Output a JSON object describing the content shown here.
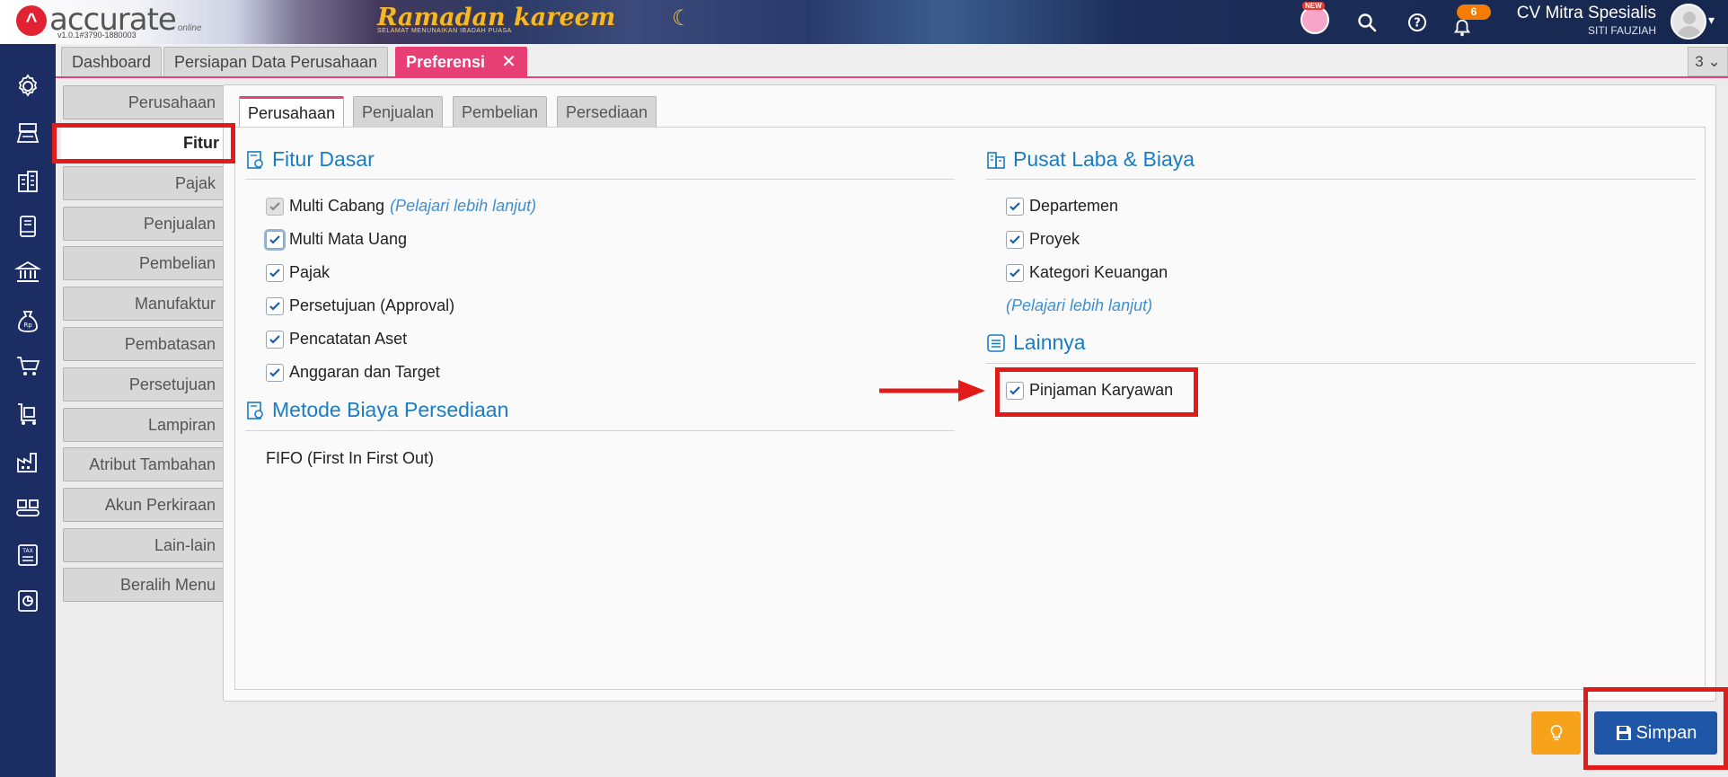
{
  "header": {
    "logo_text": "accurate",
    "logo_online": "online",
    "version": "v1.0.1#3790-1880003",
    "banner_title": "Ramadan kareem",
    "banner_sub": "SELAMAT MENUNAIKAN IBADAH PUASA",
    "new_badge": "NEW",
    "notification_count": "6",
    "company_name": "CV Mitra Spesialis",
    "user_name": "SITI FAUZIAH",
    "icons": [
      "mascot-icon",
      "search-icon",
      "help-icon",
      "bell-icon",
      "avatar",
      "chevron-down-icon"
    ]
  },
  "page_tabs": [
    {
      "label": "Dashboard"
    },
    {
      "label": "Persiapan Data Perusahaan"
    },
    {
      "label": "Preferensi",
      "active": true
    }
  ],
  "tab_count": "3",
  "left_nav_icons": [
    "settings-icon",
    "cash-register-icon",
    "building-icon",
    "book-icon",
    "bank-icon",
    "money-bag-icon",
    "shopping-cart-icon",
    "delivery-cart-icon",
    "factory-icon",
    "conveyor-icon",
    "tax-icon",
    "report-chart-icon"
  ],
  "pref_menu": [
    "Perusahaan",
    "Fitur",
    "Pajak",
    "Penjualan",
    "Pembelian",
    "Manufaktur",
    "Pembatasan",
    "Persetujuan",
    "Lampiran",
    "Atribut Tambahan",
    "Akun Perkiraan",
    "Lain-lain",
    "Beralih Menu"
  ],
  "pref_menu_active": "Fitur",
  "sub_tabs": [
    "Perusahaan",
    "Penjualan",
    "Pembelian",
    "Persediaan"
  ],
  "fitur_dasar": {
    "title": "Fitur Dasar",
    "items": [
      {
        "label": "Multi Cabang",
        "note": "(Pelajari lebih lanjut)",
        "checked": true,
        "disabled": true
      },
      {
        "label": "Multi Mata Uang",
        "checked": true
      },
      {
        "label": "Pajak",
        "checked": true
      },
      {
        "label": "Persetujuan (Approval)",
        "checked": true
      },
      {
        "label": "Pencatatan Aset",
        "checked": true
      },
      {
        "label": "Anggaran dan Target",
        "checked": true
      }
    ]
  },
  "metode_biaya": {
    "title": "Metode Biaya Persediaan",
    "value": "FIFO (First In First Out)"
  },
  "pusat_laba": {
    "title": "Pusat Laba & Biaya",
    "items": [
      {
        "label": "Departemen",
        "checked": true
      },
      {
        "label": "Proyek",
        "checked": true
      },
      {
        "label": "Kategori Keuangan",
        "checked": true
      }
    ],
    "note": "(Pelajari lebih lanjut)"
  },
  "lainnya": {
    "title": "Lainnya",
    "items": [
      {
        "label": "Pinjaman Karyawan",
        "checked": true
      }
    ]
  },
  "buttons": {
    "idea_icon": "lightbulb-icon",
    "save_label": "Simpan",
    "save_icon": "floppy-disk-icon"
  },
  "colors": {
    "accent_pink": "#e73f74",
    "nav_blue": "#1c2d63",
    "link_blue": "#1a7dc4",
    "save_blue": "#1f56a8",
    "idea_orange": "#f7a21b",
    "highlight_red": "#e11a1a"
  }
}
